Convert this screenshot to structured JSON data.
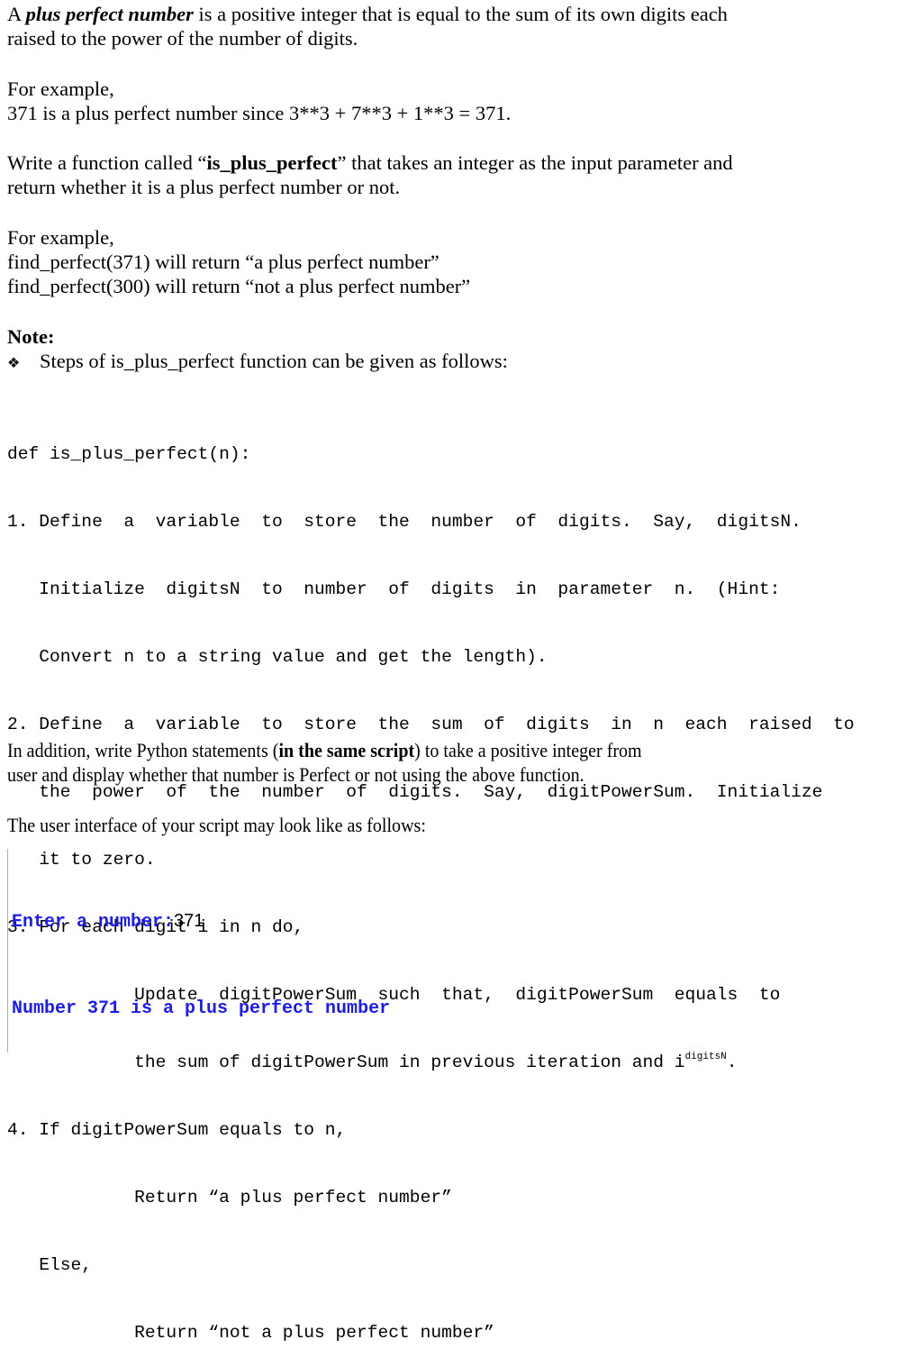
{
  "intro": {
    "prefix": "A ",
    "term": "plus perfect number",
    "line1_rest": " is a positive integer that is equal to the sum of its own digits each",
    "line2": "raised to the power of the number of digits."
  },
  "example1": {
    "heading": "For example,",
    "line": "371 is a plus perfect number since 3**3 + 7**3 + 1**3 = 371."
  },
  "task": {
    "line1_prefix": "Write a function called “",
    "function_name": "is_plus_perfect",
    "line1_suffix": "” that takes an integer as the input parameter and",
    "line2": "return whether it is a plus perfect number or not."
  },
  "example2": {
    "heading": "For example,",
    "lines": [
      "find_perfect(371) will return “a plus perfect number”",
      "find_perfect(300) will return “not a plus perfect number”"
    ]
  },
  "note": {
    "heading": "Note:",
    "bullet_icon": "❖",
    "bullet_text": "Steps of is_plus_perfect function can be given as follows:"
  },
  "steps": {
    "lines": [
      "def is_plus_perfect(n):",
      "1. Define  a  variable  to  store  the  number  of  digits.  Say,  digitsN.",
      "   Initialize  digitsN  to  number  of  digits  in  parameter  n.  (Hint:",
      "   Convert n to a string value and get the length).",
      "2. Define  a  variable  to  store  the  sum  of  digits  in  n  each  raised  to",
      "   the  power  of  the  number  of  digits.  Say,  digitPowerSum.  Initialize",
      "   it to zero.",
      "3. For each digit i in n do,",
      "            Update  digitPowerSum  such  that,  digitPowerSum  equals  to",
      "            the sum of digitPowerSum in previous iteration and i",
      "4. If digitPowerSum equals to n,",
      "            Return “a plus perfect number”",
      "   Else,",
      "            Return “not a plus perfect number”"
    ],
    "superscript": "digitsN",
    "superscript_suffix": "."
  },
  "addition": {
    "line1_prefix": "In addition, write Python statements (",
    "line1_bold": "in the same script",
    "line1_suffix": ") to take a positive integer from",
    "line2": "user and display whether that number is Perfect or not using the above function."
  },
  "ui_intro": "The user interface of your script may look like as follows:",
  "console": {
    "prompt": "Enter a number:",
    "input_value": "371",
    "output": "Number 371 is a plus perfect number",
    "text_color": "#1a1aff"
  }
}
